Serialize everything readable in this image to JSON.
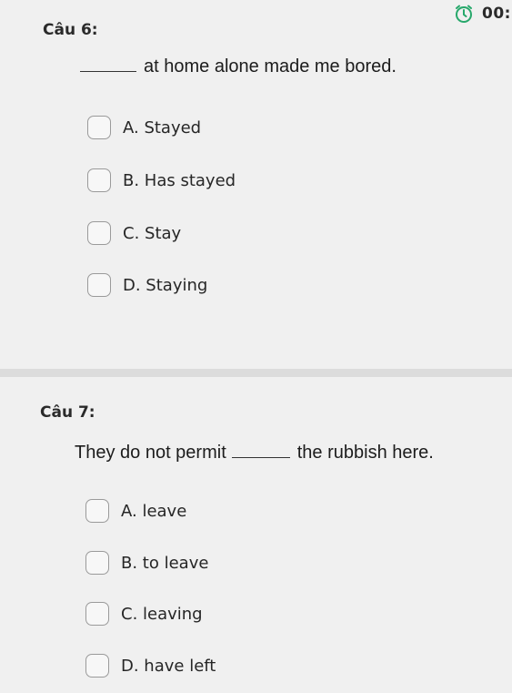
{
  "timer": {
    "text": "00:",
    "icon": "alarm-clock-icon",
    "accent_color": "#27a86b"
  },
  "questions": [
    {
      "number": "Câu 6:",
      "prompt_before": "",
      "prompt_after": "at home alone made me bored.",
      "options": [
        "A. Stayed",
        "B. Has stayed",
        "C. Stay",
        "D. Staying"
      ]
    },
    {
      "number": "Câu 7:",
      "prompt_before": "They do not permit",
      "prompt_after": "the rubbish here.",
      "options": [
        "A. leave",
        "B. to leave",
        "C. leaving",
        "D. have left"
      ]
    }
  ]
}
